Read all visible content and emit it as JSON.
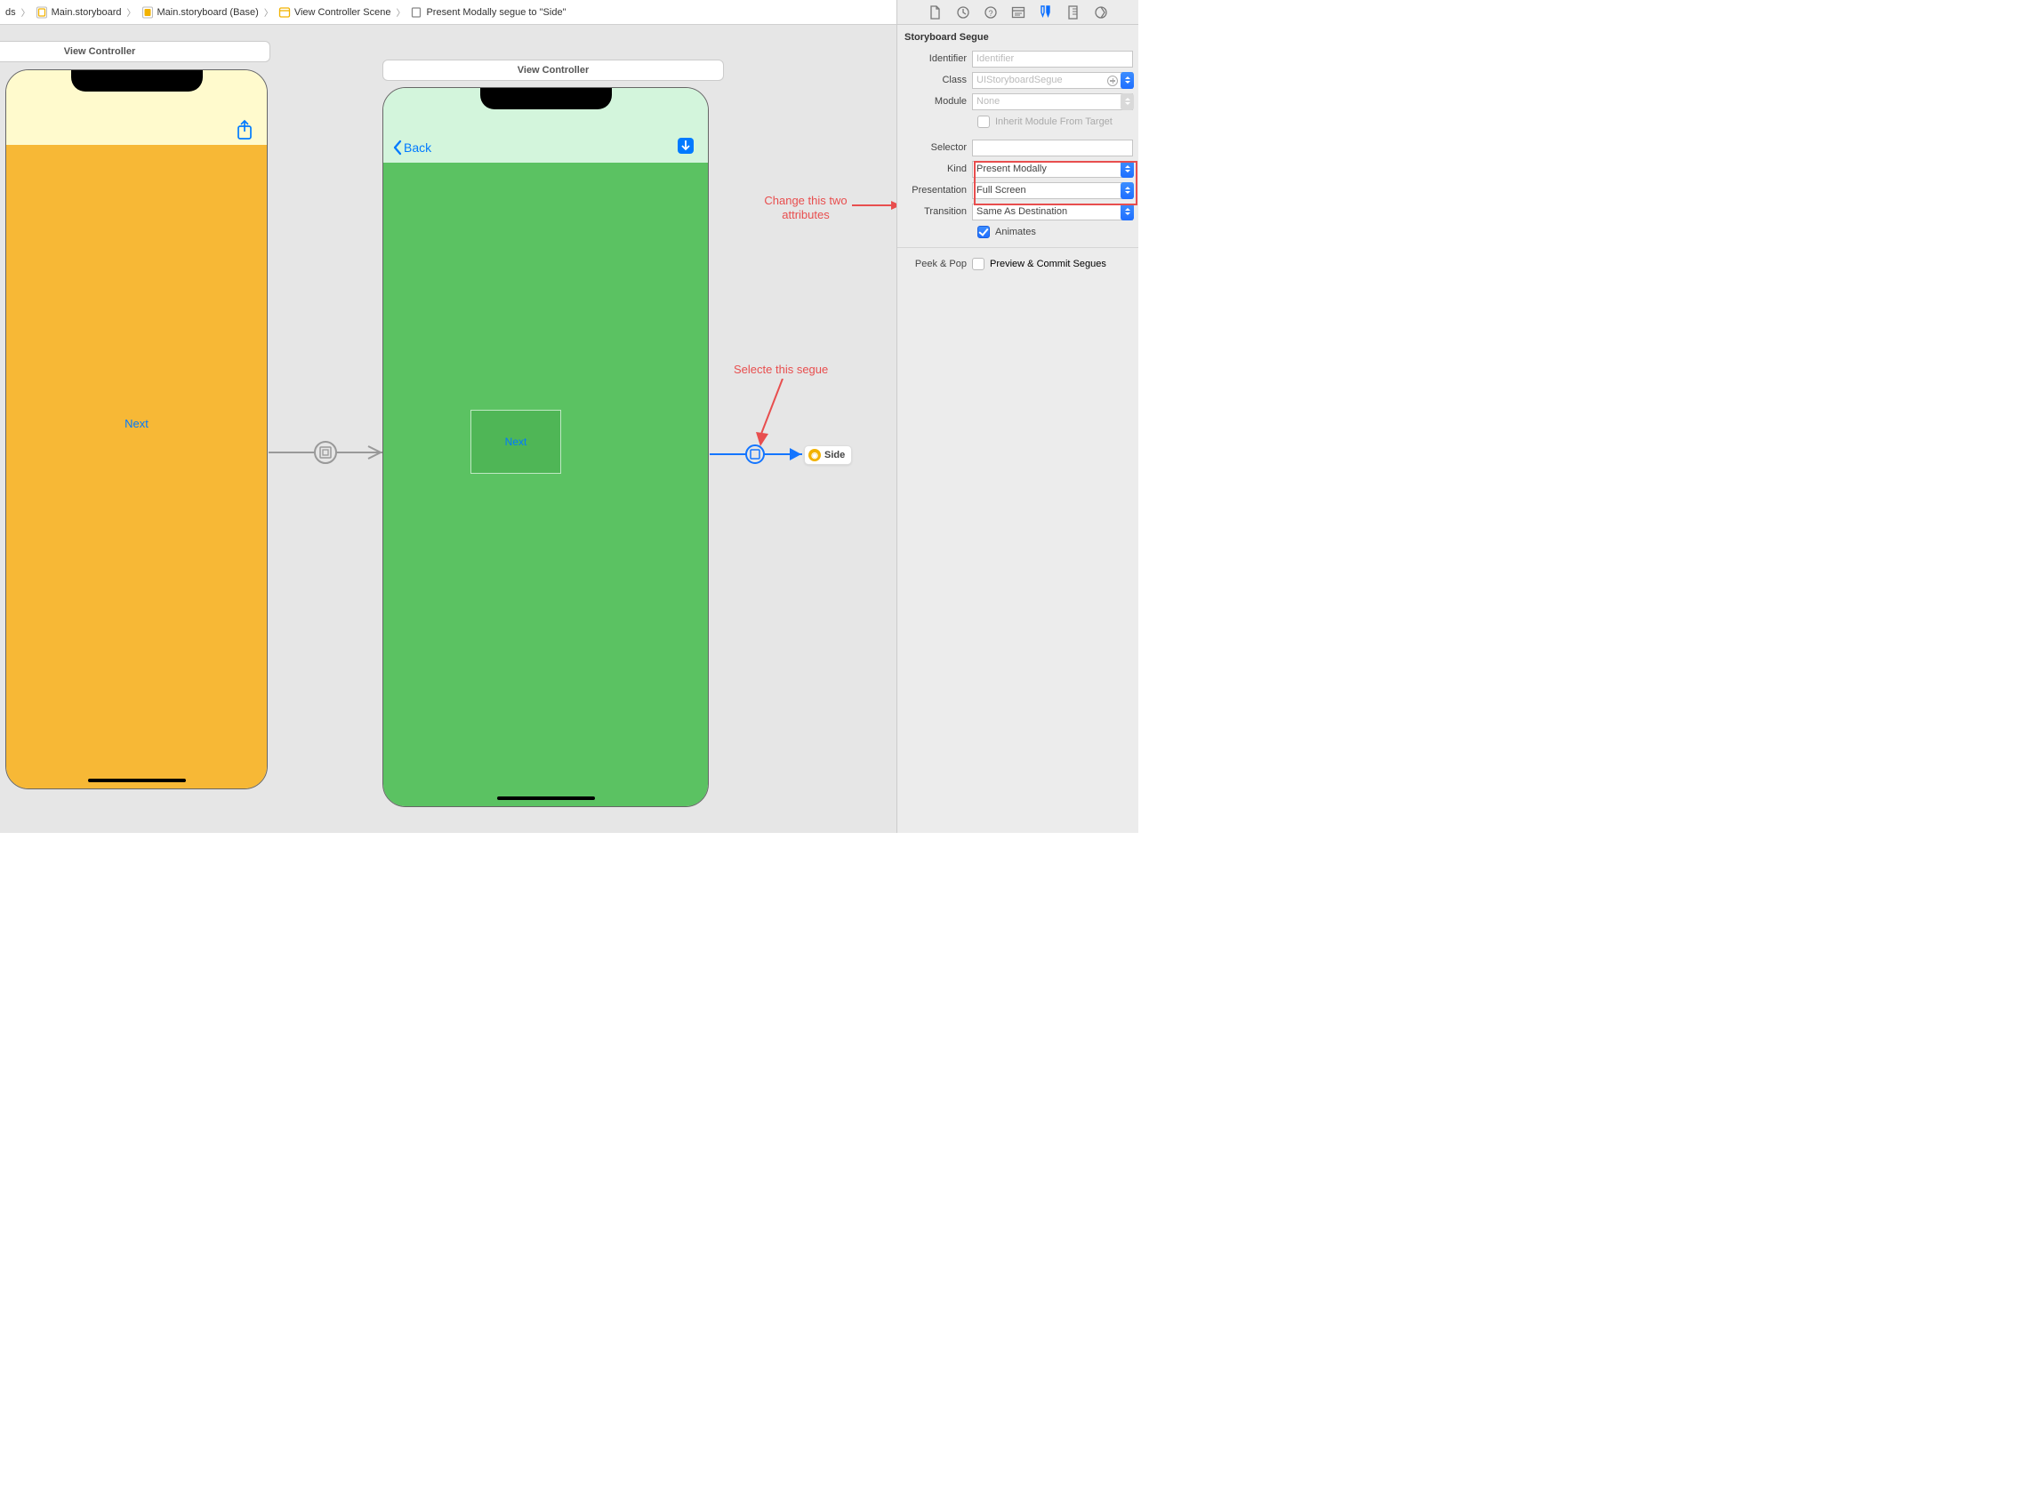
{
  "breadcrumb": {
    "dsLabel": "ds",
    "mainStoryboard": "Main.storyboard",
    "mainStoryboardBase": "Main.storyboard (Base)",
    "vcScene": "View Controller Scene",
    "segue": "Present Modally segue to \"Side\""
  },
  "canvas": {
    "vc1Title": "View Controller",
    "vc2Title": "View Controller",
    "vc1NextLabel": "Next",
    "vc2BackLabel": "Back",
    "vc2ContainerLabel": "Next",
    "sideBadgeLabel": "Side"
  },
  "annotations": {
    "changeAttributes": "Change this two\nattributes",
    "selectSegue": "Selecte this segue"
  },
  "inspector": {
    "sectionTitle": "Storyboard Segue",
    "identifierLabel": "Identifier",
    "identifierPlaceholder": "Identifier",
    "classLabel": "Class",
    "classValue": "UIStoryboardSegue",
    "moduleLabel": "Module",
    "moduleValue": "None",
    "inheritLabel": "Inherit Module From Target",
    "selectorLabel": "Selector",
    "selectorValue": "",
    "kindLabel": "Kind",
    "kindValue": "Present Modally",
    "presentationLabel": "Presentation",
    "presentationValue": "Full Screen",
    "transitionLabel": "Transition",
    "transitionValue": "Same As Destination",
    "animatesLabel": "Animates",
    "peekPopLabel": "Peek & Pop",
    "peekPopValue": "Preview & Commit Segues"
  }
}
